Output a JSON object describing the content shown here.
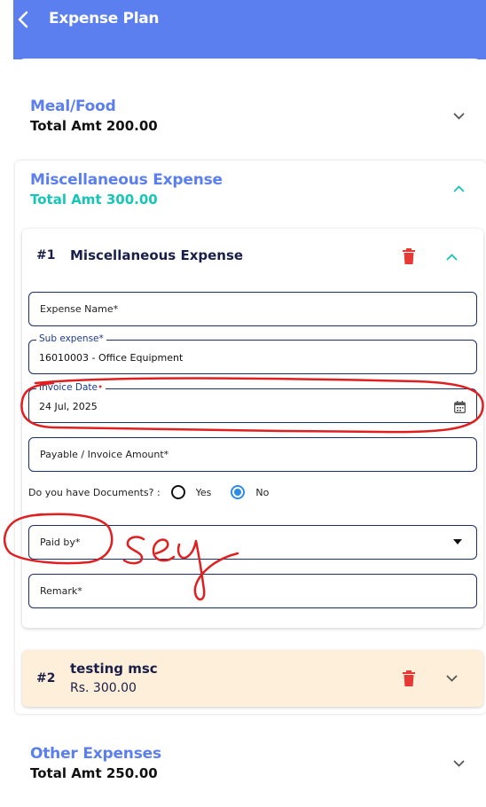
{
  "appbar": {
    "title": "Expense Plan"
  },
  "sections": [
    {
      "title": "Meal/Food",
      "total": "Total Amt 200.00",
      "expanded": false
    },
    {
      "title": "Miscellaneous Expense",
      "total": "Total Amt 300.00",
      "expanded": true
    },
    {
      "title": "Other Expenses",
      "total": "Total Amt 250.00",
      "expanded": false
    }
  ],
  "item1": {
    "number": "#1",
    "title": "Miscellaneous Expense",
    "fields": {
      "expense_name": {
        "label": "Expense Name*"
      },
      "sub_expense": {
        "label": "Sub expense*",
        "value": "16010003 - Office Equipment"
      },
      "invoice_date": {
        "label": "Invoice Date",
        "value": "24 Jul, 2025"
      },
      "amount": {
        "label": "Payable / Invoice Amount*"
      },
      "paid_by": {
        "label": "Paid by*"
      },
      "remark": {
        "label": "Remark*"
      }
    },
    "documents": {
      "question": "Do you have Documents? :",
      "yes": "Yes",
      "no": "No",
      "selected": "No"
    }
  },
  "item2": {
    "number": "#2",
    "title": "testing msc",
    "amount": "Rs. 300.00"
  },
  "annotation": {
    "text": "sey"
  },
  "colors": {
    "primary": "#5b7fee",
    "teal": "#16c6b6",
    "danger": "#e53935",
    "item2_bg": "#fdefd9",
    "field_border": "#1b2f6b"
  }
}
